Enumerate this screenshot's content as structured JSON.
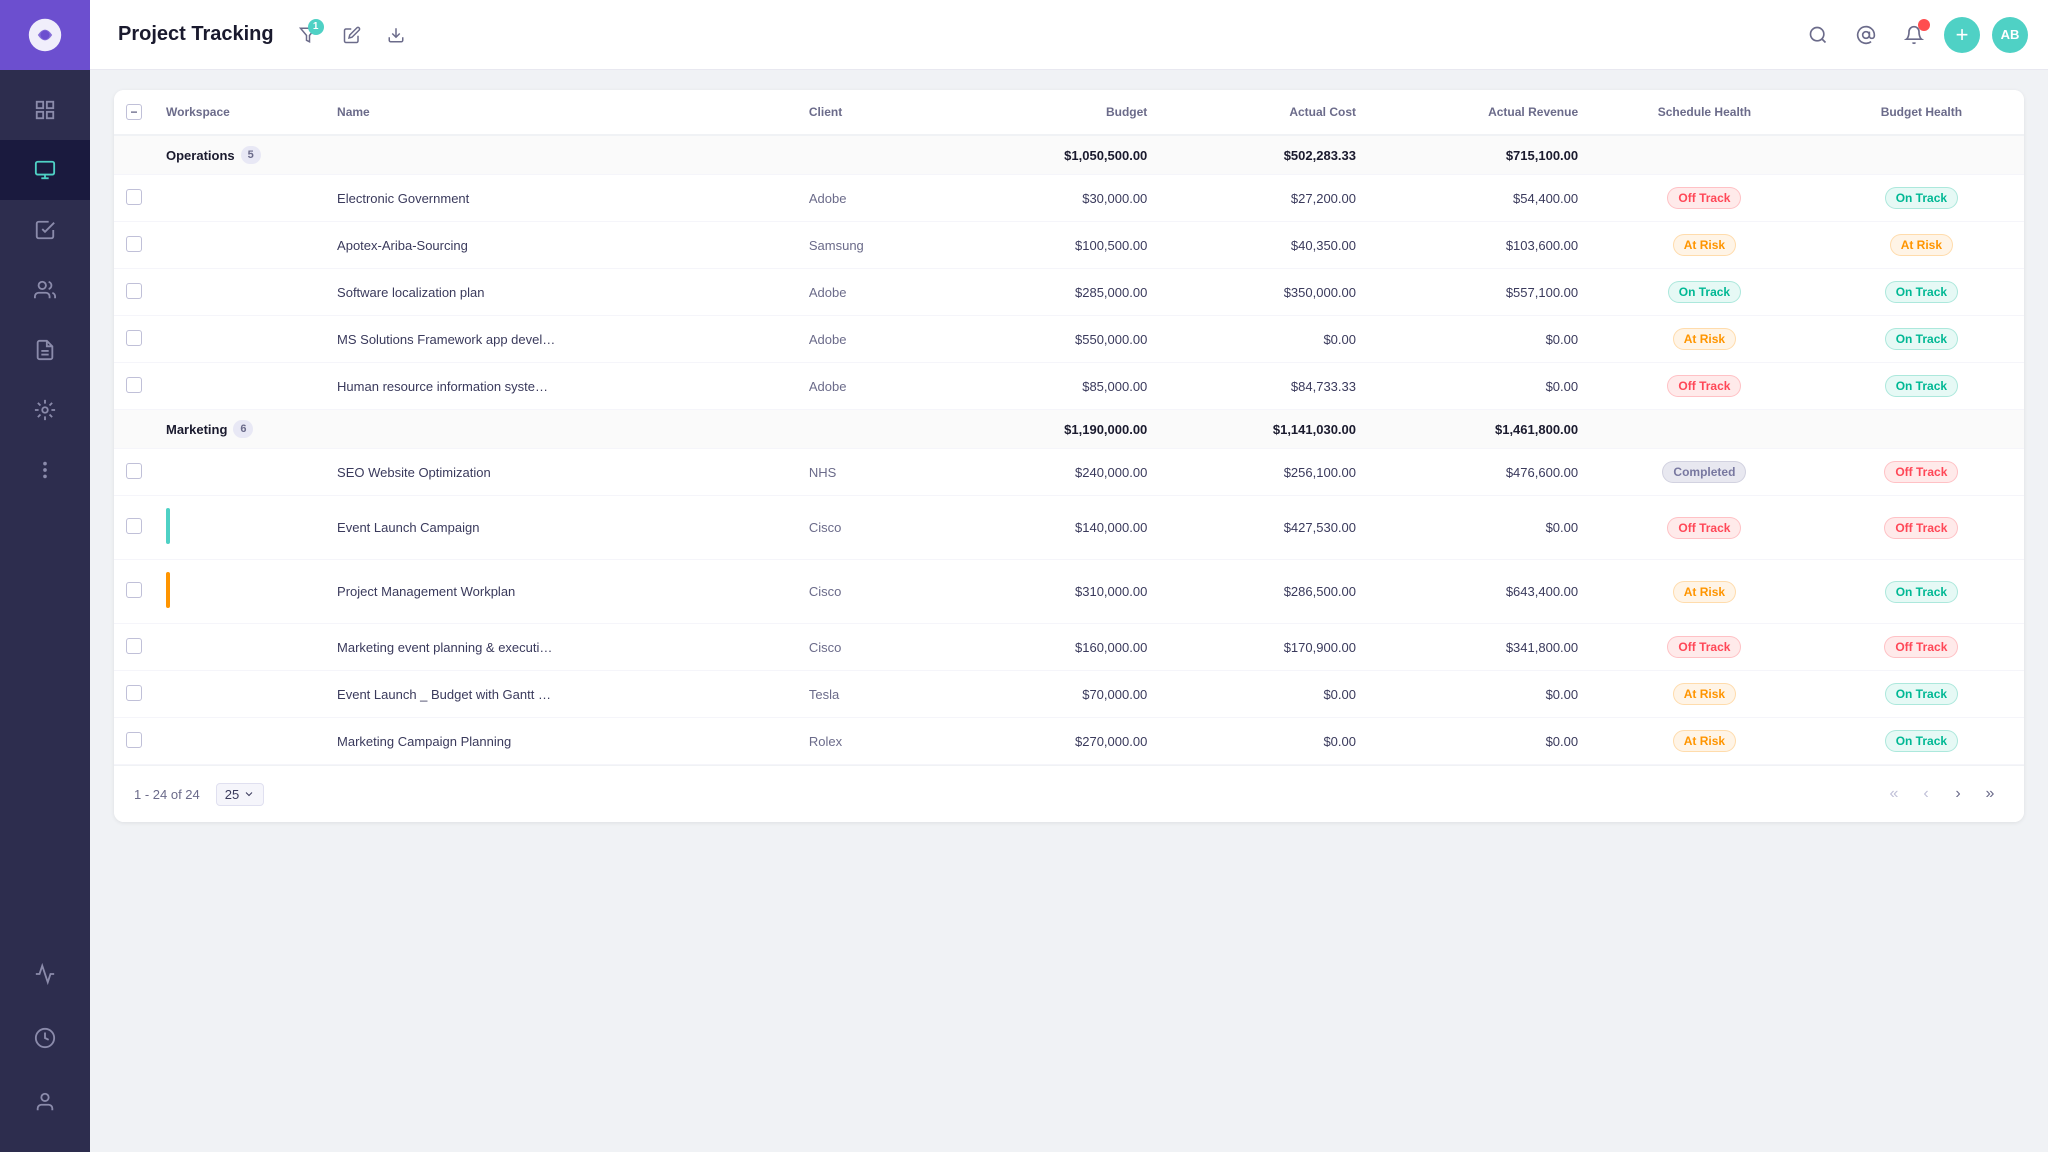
{
  "app": {
    "title": "Project Tracking",
    "logo_initials": "C"
  },
  "header": {
    "filter_badge": "1",
    "avatar_text": "AB",
    "add_label": "+"
  },
  "table": {
    "columns": [
      "Workspace",
      "Name",
      "Client",
      "Budget",
      "Actual Cost",
      "Actual Revenue",
      "Schedule Health",
      "Budget Health"
    ],
    "groups": [
      {
        "name": "Operations",
        "count": "5",
        "budget": "$1,050,500.00",
        "actual_cost": "$502,283.33",
        "actual_revenue": "$715,100.00",
        "rows": [
          {
            "name": "Electronic Government",
            "client": "Adobe",
            "budget": "$30,000.00",
            "actual_cost": "$27,200.00",
            "actual_revenue": "$54,400.00",
            "schedule_health": "Off Track",
            "budget_health": "On Track",
            "color_bar": ""
          },
          {
            "name": "Apotex-Ariba-Sourcing",
            "client": "Samsung",
            "budget": "$100,500.00",
            "actual_cost": "$40,350.00",
            "actual_revenue": "$103,600.00",
            "schedule_health": "At Risk",
            "budget_health": "At Risk",
            "color_bar": ""
          },
          {
            "name": "Software localization plan",
            "client": "Adobe",
            "budget": "$285,000.00",
            "actual_cost": "$350,000.00",
            "actual_revenue": "$557,100.00",
            "schedule_health": "On Track",
            "budget_health": "On Track",
            "color_bar": ""
          },
          {
            "name": "MS Solutions Framework app devel…",
            "client": "Adobe",
            "budget": "$550,000.00",
            "actual_cost": "$0.00",
            "actual_revenue": "$0.00",
            "schedule_health": "At Risk",
            "budget_health": "On Track",
            "color_bar": ""
          },
          {
            "name": "Human resource information syste…",
            "client": "Adobe",
            "budget": "$85,000.00",
            "actual_cost": "$84,733.33",
            "actual_revenue": "$0.00",
            "schedule_health": "Off Track",
            "budget_health": "On Track",
            "color_bar": ""
          }
        ]
      },
      {
        "name": "Marketing",
        "count": "6",
        "budget": "$1,190,000.00",
        "actual_cost": "$1,141,030.00",
        "actual_revenue": "$1,461,800.00",
        "rows": [
          {
            "name": "SEO Website Optimization",
            "client": "NHS",
            "budget": "$240,000.00",
            "actual_cost": "$256,100.00",
            "actual_revenue": "$476,600.00",
            "schedule_health": "Completed",
            "budget_health": "Off Track",
            "color_bar": ""
          },
          {
            "name": "Event Launch Campaign",
            "client": "Cisco",
            "budget": "$140,000.00",
            "actual_cost": "$427,530.00",
            "actual_revenue": "$0.00",
            "schedule_health": "Off Track",
            "budget_health": "Off Track",
            "color_bar": "green"
          },
          {
            "name": "Project Management Workplan",
            "client": "Cisco",
            "budget": "$310,000.00",
            "actual_cost": "$286,500.00",
            "actual_revenue": "$643,400.00",
            "schedule_health": "At Risk",
            "budget_health": "On Track",
            "color_bar": "orange"
          },
          {
            "name": "Marketing event planning & executi…",
            "client": "Cisco",
            "budget": "$160,000.00",
            "actual_cost": "$170,900.00",
            "actual_revenue": "$341,800.00",
            "schedule_health": "Off Track",
            "budget_health": "Off Track",
            "color_bar": ""
          },
          {
            "name": "Event Launch _ Budget with Gantt …",
            "client": "Tesla",
            "budget": "$70,000.00",
            "actual_cost": "$0.00",
            "actual_revenue": "$0.00",
            "schedule_health": "At Risk",
            "budget_health": "On Track",
            "color_bar": ""
          },
          {
            "name": "Marketing Campaign Planning",
            "client": "Rolex",
            "budget": "$270,000.00",
            "actual_cost": "$0.00",
            "actual_revenue": "$0.00",
            "schedule_health": "At Risk",
            "budget_health": "On Track",
            "color_bar": ""
          }
        ]
      }
    ]
  },
  "pagination": {
    "range": "1 - 24 of 24",
    "per_page": "25"
  },
  "sidebar": {
    "items": [
      {
        "icon": "dashboard",
        "label": "Dashboard"
      },
      {
        "icon": "projects",
        "label": "Projects",
        "active": true
      },
      {
        "icon": "tasks",
        "label": "Tasks"
      },
      {
        "icon": "team",
        "label": "Team"
      },
      {
        "icon": "documents",
        "label": "Documents"
      },
      {
        "icon": "integrations",
        "label": "Integrations"
      },
      {
        "icon": "more",
        "label": "More"
      }
    ]
  },
  "badges": {
    "on_track": "On Track",
    "off_track": "Off Track",
    "at_risk": "At Risk",
    "completed": "Completed"
  }
}
